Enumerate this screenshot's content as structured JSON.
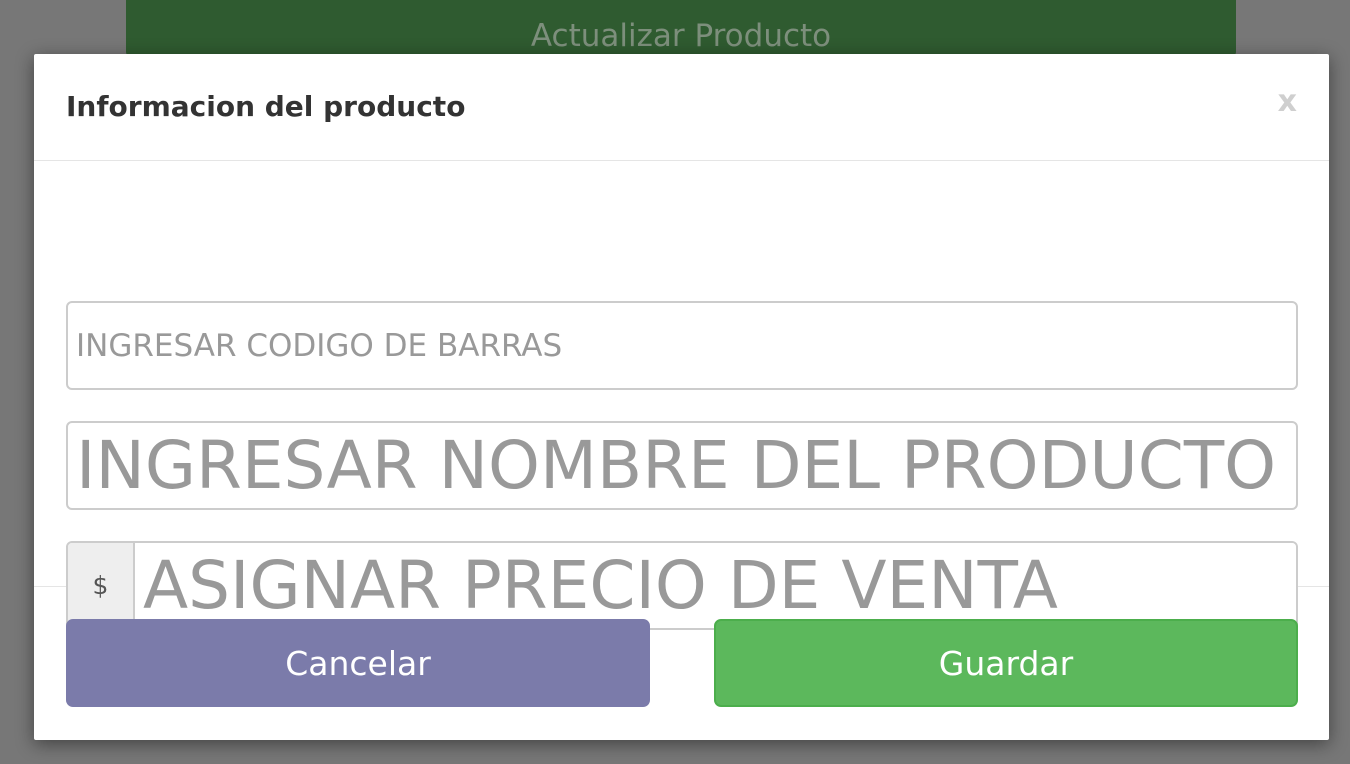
{
  "background": {
    "update_button_label": "Actualizar Producto"
  },
  "modal": {
    "title": "Informacion del producto",
    "close_label": "x",
    "barcode_placeholder": "INGRESAR CODIGO DE BARRAS",
    "name_placeholder": "INGRESAR NOMBRE DEL PRODUCTO",
    "price_addon": "$",
    "price_placeholder": "ASIGNAR PRECIO DE VENTA",
    "cancel_label": "Cancelar",
    "save_label": "Guardar"
  },
  "colors": {
    "overlay": "#777777",
    "cancel_button": "#7b7baa",
    "save_button": "#5cb85c",
    "background_button": "#2f5b30"
  }
}
